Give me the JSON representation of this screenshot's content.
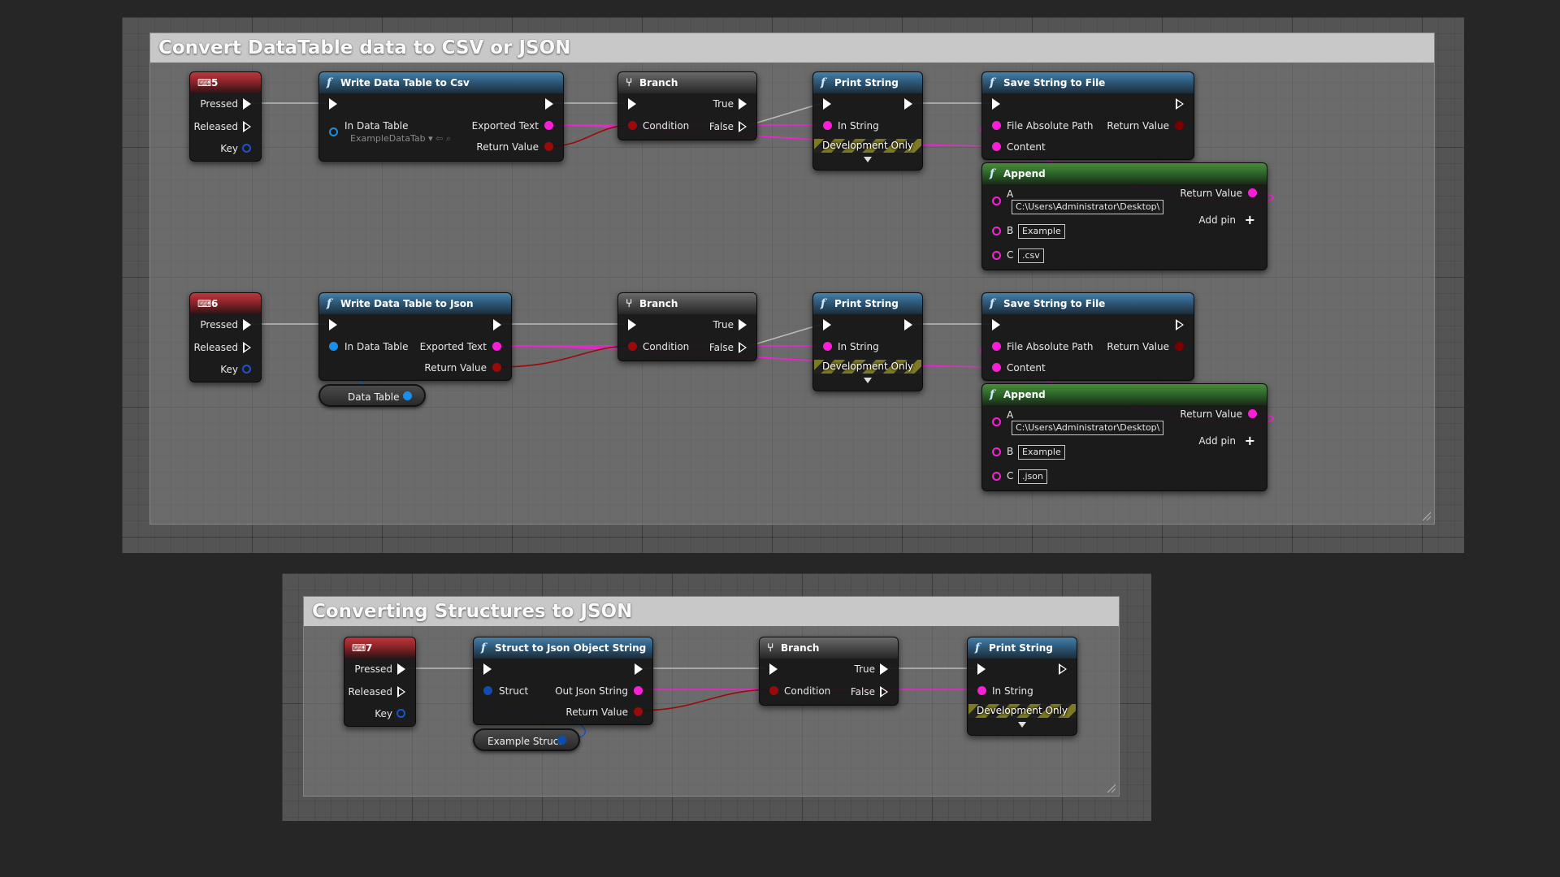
{
  "colors": {
    "string_pin": "#f81fd6",
    "bool_pin": "#9a0a0a",
    "object_pin": "#1b8ee8",
    "struct_pin": "#0d4eb0",
    "exec_pin": "#ffffff",
    "function_header": "#2f5f82",
    "event_header": "#8a2428",
    "branch_header": "#4a4a4a",
    "pure_header": "#2e6a2a",
    "graph_bg": "#545454",
    "comment_title_bg": "#c8c8c8"
  },
  "comments": [
    {
      "title": "Convert DataTable data to CSV or JSON"
    },
    {
      "title": "Converting Structures to JSON"
    }
  ],
  "csv_row": {
    "event": {
      "key": "5",
      "pressed": "Pressed",
      "released": "Released",
      "key_label": "Key"
    },
    "write": {
      "title": "Write Data Table to Csv",
      "in_table": "In Data Table",
      "dropdown": "ExampleDataTab",
      "exported": "Exported Text",
      "return": "Return Value"
    },
    "branch": {
      "title": "Branch",
      "true": "True",
      "condition": "Condition",
      "false": "False"
    },
    "print": {
      "title": "Print String",
      "in_string": "In String",
      "dev": "Development Only"
    },
    "save": {
      "title": "Save String to File",
      "path": "File Absolute Path",
      "return": "Return Value",
      "content": "Content"
    },
    "append": {
      "title": "Append",
      "a": "A",
      "a_value": "C:\\Users\\Administrator\\Desktop\\",
      "return": "Return Value",
      "add_pin": "Add pin",
      "b": "B",
      "b_value": "Example",
      "c": "C",
      "c_value": ".csv"
    }
  },
  "json_row": {
    "event": {
      "key": "6",
      "pressed": "Pressed",
      "released": "Released",
      "key_label": "Key"
    },
    "write": {
      "title": "Write Data Table to Json",
      "in_table": "In Data Table",
      "exported": "Exported Text",
      "return": "Return Value"
    },
    "var": {
      "label": "Data Table"
    },
    "branch": {
      "title": "Branch",
      "true": "True",
      "condition": "Condition",
      "false": "False"
    },
    "print": {
      "title": "Print String",
      "in_string": "In String",
      "dev": "Development Only"
    },
    "save": {
      "title": "Save String to File",
      "path": "File Absolute Path",
      "return": "Return Value",
      "content": "Content"
    },
    "append": {
      "title": "Append",
      "a": "A",
      "a_value": "C:\\Users\\Administrator\\Desktop\\",
      "return": "Return Value",
      "add_pin": "Add pin",
      "b": "B",
      "b_value": "Example",
      "c": "C",
      "c_value": ".json"
    }
  },
  "struct_row": {
    "event": {
      "key": "7",
      "pressed": "Pressed",
      "released": "Released",
      "key_label": "Key"
    },
    "convert": {
      "title": "Struct to Json Object String",
      "struct": "Struct",
      "out": "Out Json String",
      "return": "Return Value"
    },
    "var": {
      "label": "Example Struct"
    },
    "branch": {
      "title": "Branch",
      "true": "True",
      "condition": "Condition",
      "false": "False"
    },
    "print": {
      "title": "Print String",
      "in_string": "In String",
      "dev": "Development Only"
    }
  }
}
